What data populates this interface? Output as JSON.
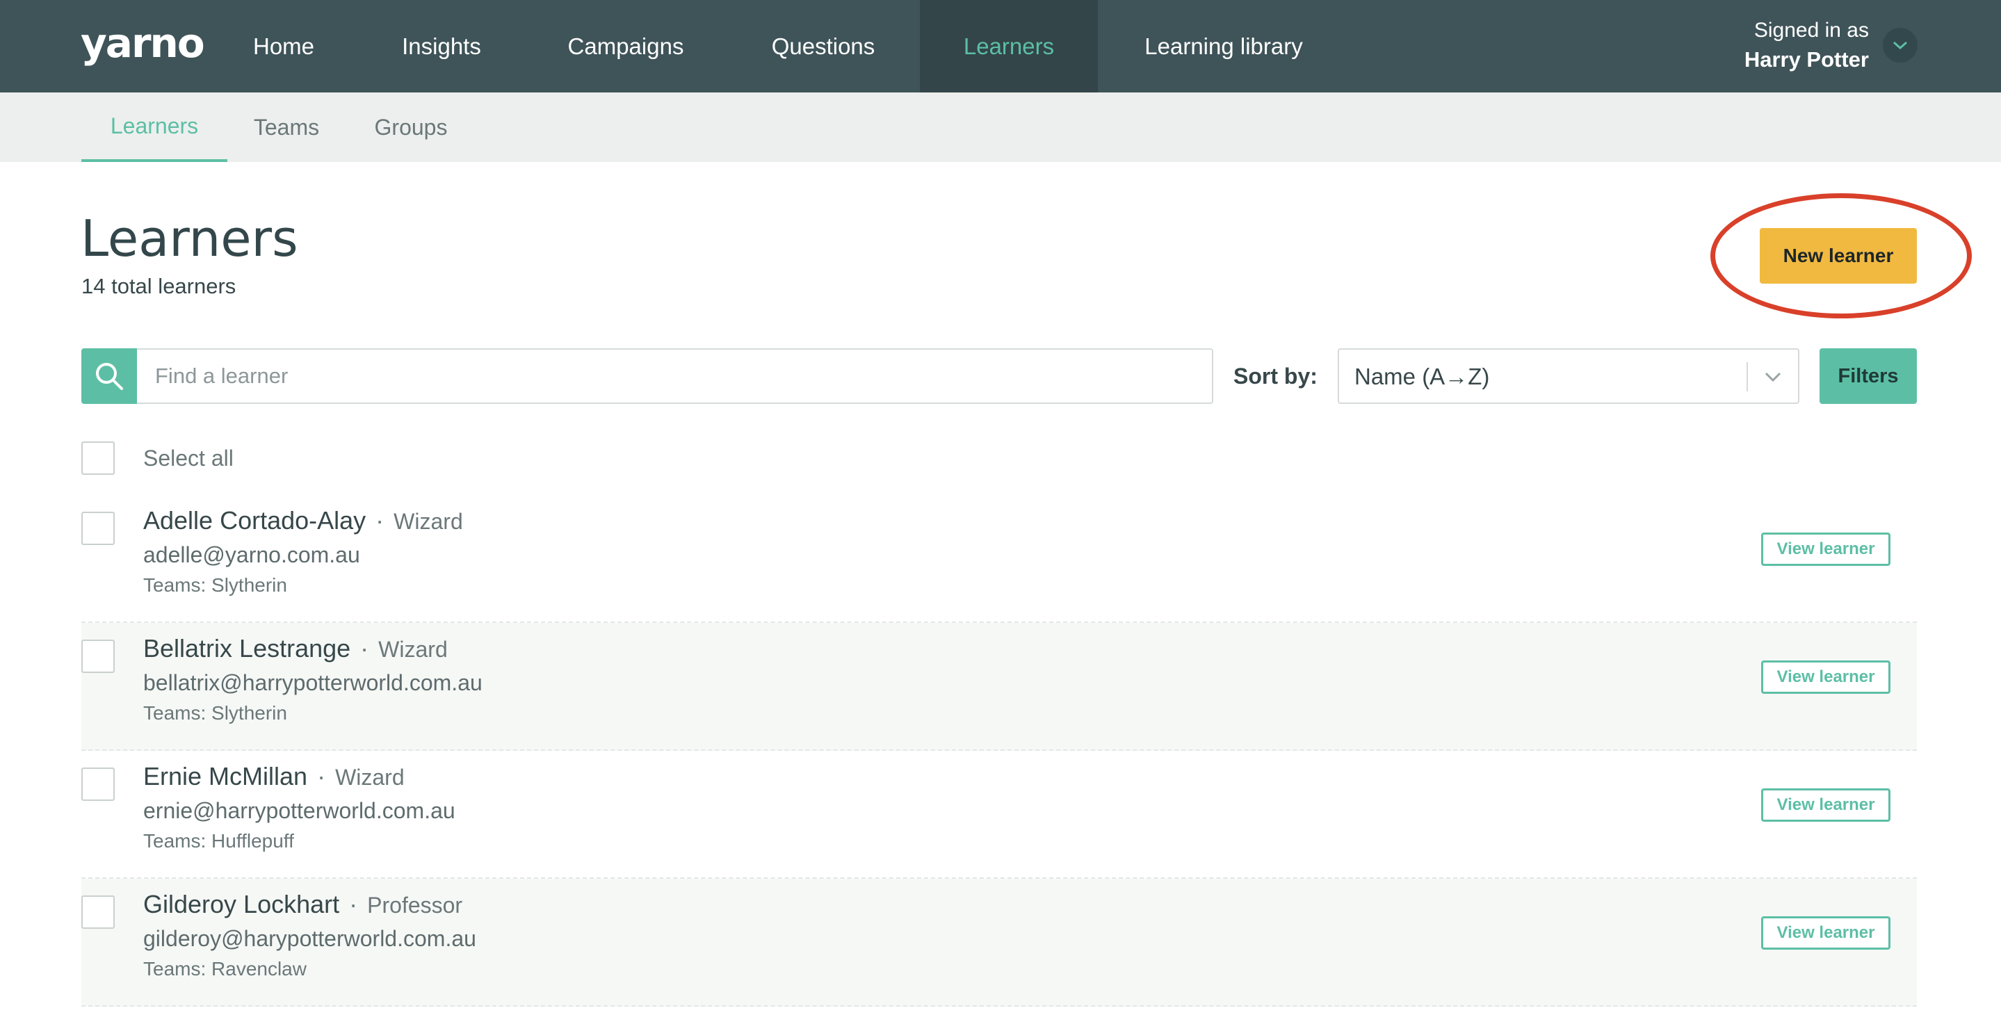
{
  "nav": {
    "logo": "yarno",
    "items": [
      {
        "label": "Home"
      },
      {
        "label": "Insights"
      },
      {
        "label": "Campaigns"
      },
      {
        "label": "Questions"
      },
      {
        "label": "Learners",
        "active": true
      },
      {
        "label": "Learning library"
      }
    ],
    "signed_in_label": "Signed in as",
    "user_name": "Harry Potter"
  },
  "subnav": {
    "items": [
      {
        "label": "Learners",
        "active": true
      },
      {
        "label": "Teams"
      },
      {
        "label": "Groups"
      }
    ]
  },
  "header": {
    "title": "Learners",
    "subtitle": "14 total learners",
    "new_button": "New learner"
  },
  "search": {
    "placeholder": "Find a learner",
    "value": ""
  },
  "sort": {
    "label": "Sort by:",
    "value": "Name (A→Z)"
  },
  "filters_label": "Filters",
  "select_all_label": "Select all",
  "learners": [
    {
      "name": "Adelle Cortado-Alay",
      "role": "Wizard",
      "email": "adelle@yarno.com.au",
      "teams": "Teams: Slytherin",
      "action": "View learner"
    },
    {
      "name": "Bellatrix Lestrange",
      "role": "Wizard",
      "email": "bellatrix@harrypotterworld.com.au",
      "teams": "Teams: Slytherin",
      "action": "View learner"
    },
    {
      "name": "Ernie McMillan",
      "role": "Wizard",
      "email": "ernie@harrypotterworld.com.au",
      "teams": "Teams: Hufflepuff",
      "action": "View learner"
    },
    {
      "name": "Gilderoy Lockhart",
      "role": "Professor",
      "email": "gilderoy@harypotterworld.com.au",
      "teams": "Teams: Ravenclaw",
      "action": "View learner"
    }
  ],
  "colors": {
    "nav_bg": "#3f5459",
    "accent": "#5cbfa5",
    "cta": "#f1b940",
    "highlight": "#d9402a"
  },
  "icons": {
    "search": "search-icon",
    "user_menu": "chevron-down-icon",
    "sort": "chevron-down-icon"
  }
}
